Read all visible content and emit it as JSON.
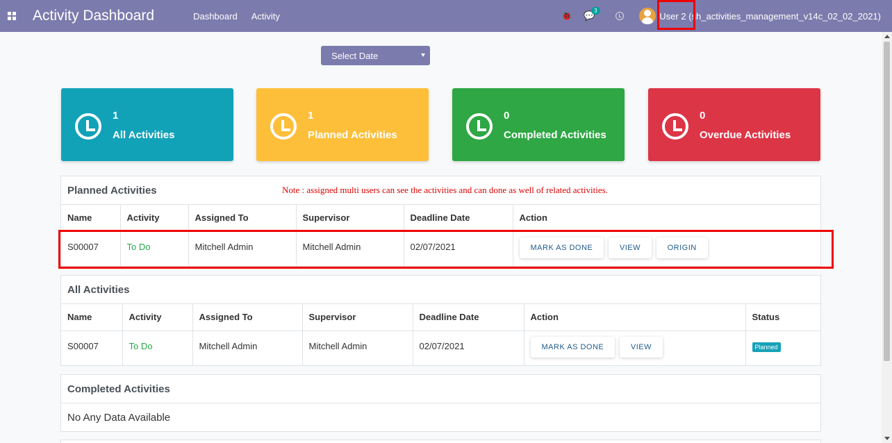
{
  "navbar": {
    "brand": "Activity Dashboard",
    "menu": [
      "Dashboard",
      "Activity"
    ],
    "messages_count": "3",
    "user": "User 2 (sh_activities_management_v14c_02_02_2021)"
  },
  "select_date": {
    "label": "Select Date"
  },
  "cards": [
    {
      "count": "1",
      "label": "All Activities",
      "color": "#12a2b8"
    },
    {
      "count": "1",
      "label": "Planned Activities",
      "color": "#fdbf3a"
    },
    {
      "count": "0",
      "label": "Completed Activities",
      "color": "#2ea744"
    },
    {
      "count": "0",
      "label": "Overdue Activities",
      "color": "#dc3546"
    }
  ],
  "planned": {
    "title": "Planned Activities",
    "note": "Note : assigned multi users can see the activities and can done as well of related activities.",
    "headers": [
      "Name",
      "Activity",
      "Assigned To",
      "Supervisor",
      "Deadline Date",
      "Action"
    ],
    "row": {
      "name": "S00007",
      "activity": "To Do",
      "assigned": "Mitchell Admin",
      "supervisor": "Mitchell Admin",
      "deadline": "02/07/2021",
      "buttons": [
        "MARK AS DONE",
        "VIEW",
        "ORIGIN"
      ]
    }
  },
  "all": {
    "title": "All Activities",
    "headers": [
      "Name",
      "Activity",
      "Assigned To",
      "Supervisor",
      "Deadline Date",
      "Action",
      "Status"
    ],
    "row": {
      "name": "S00007",
      "activity": "To Do",
      "assigned": "Mitchell Admin",
      "supervisor": "Mitchell Admin",
      "deadline": "02/07/2021",
      "buttons": [
        "MARK AS DONE",
        "VIEW"
      ],
      "status": "Planned"
    }
  },
  "completed": {
    "title": "Completed Activities",
    "empty": "No Any Data Available"
  }
}
